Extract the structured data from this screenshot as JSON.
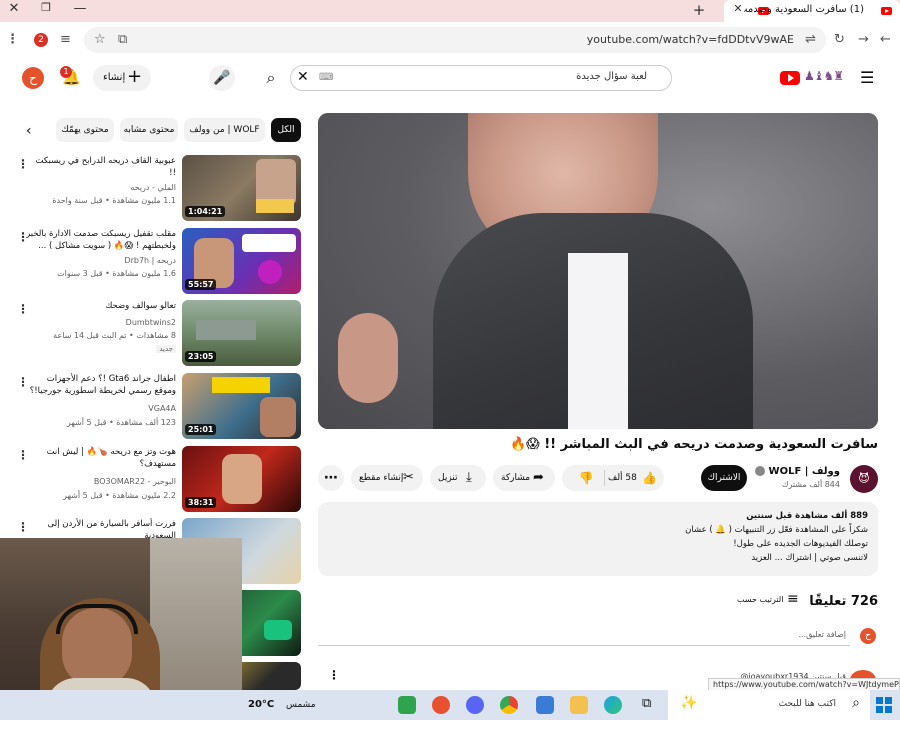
{
  "browser": {
    "tab_title": "(1) سافرت السعودية وصدمت...",
    "url": "youtube.com/watch?v=fdDDtvV9wAE",
    "profile_badge": "2",
    "status_url": "https://www.youtube.com/watch?v=WJtdymePK7M"
  },
  "header": {
    "search_query": "لعبة سؤال جديدة",
    "create_label": "إنشاء",
    "notif_count": "1",
    "avatar_letter": "ح"
  },
  "chips": [
    "الكل",
    "من وولف | WOLF",
    "محتوى مشابه",
    "محتوى يهمّك"
  ],
  "sidebar": [
    {
      "title": "عبوبية القاف دريحه الدرابح في ريسبكت !!",
      "channel": "الملي - دريحه",
      "meta": "1.1 مليون مشاهدة • قبل سنة واحدة",
      "duration": "1:04:21",
      "new": ""
    },
    {
      "title": "مقلب تقفيل ريسبكت صدمت الادارة بالخبر ولخبطتهم ! 😱🔥 ( سويت مشاكل ) ...",
      "channel": "دريحه | Drb7h",
      "meta": "1.6 مليون مشاهدة • قبل 3 سنوات",
      "duration": "55:57",
      "new": ""
    },
    {
      "title": "تعالو سوالف وضحك",
      "channel": "Dumbtwins2",
      "meta": "8 مشاهدات • تم البث قبل 14 ساعة",
      "duration": "23:05",
      "new": "جديد"
    },
    {
      "title": "اطفال جراند Gta6 !؟ دعم الأجهزات وموقع رسمي لخريطة اسطورية جورجيا!؟ تفاصيل ...",
      "channel": "VGA4A",
      "meta": "123 ألف مشاهدة • قبل 5 أشهر",
      "duration": "25:01",
      "new": ""
    },
    {
      "title": "هوت وتز مع دريحه 🍗🔥 | ليش انت مستهدف؟",
      "channel": "البوحير - BO3OMAR22",
      "meta": "2.2 مليون مشاهدة • قبل 5 أشهر",
      "duration": "38:31",
      "new": ""
    },
    {
      "title": "فررت أسافر بالسيارة من الأردن إلى السعودية",
      "channel": "",
      "meta": "",
      "duration": "",
      "new": ""
    }
  ],
  "video": {
    "title": "سافرت السعودية وصدمت دريحه في البث المباشر !! 😱🔥",
    "channel": "وولف | WOLF",
    "subscribers": "844 ألف مشترك",
    "subscribe_label": "الاشتراك",
    "likes": "58 ألف",
    "share_label": "مشاركة",
    "download_label": "تنزيل",
    "clip_label": "إنشاء مقطع",
    "desc_line1": "889 ألف مشاهدة قبل سنتين",
    "desc_line2": "شكراً على المشاهدة فعّل زر التنبيهات ( 🔔 ) عشان",
    "desc_line3": "توصلك الفيديوهات الجديده على طول!",
    "desc_line4": "لاتنسى صوتي | اشتراك ... العزيد"
  },
  "comments": {
    "count": "726 تعليقًا",
    "sort_label": "الترتيب حسب",
    "add_placeholder": "إضافة تعليق...",
    "first_author": "@joayoubxr1934 قبل سنتين"
  },
  "taskbar": {
    "search_placeholder": "اكتب هنا للبحث",
    "weather_label": "مشمس",
    "temperature": "20°C"
  }
}
